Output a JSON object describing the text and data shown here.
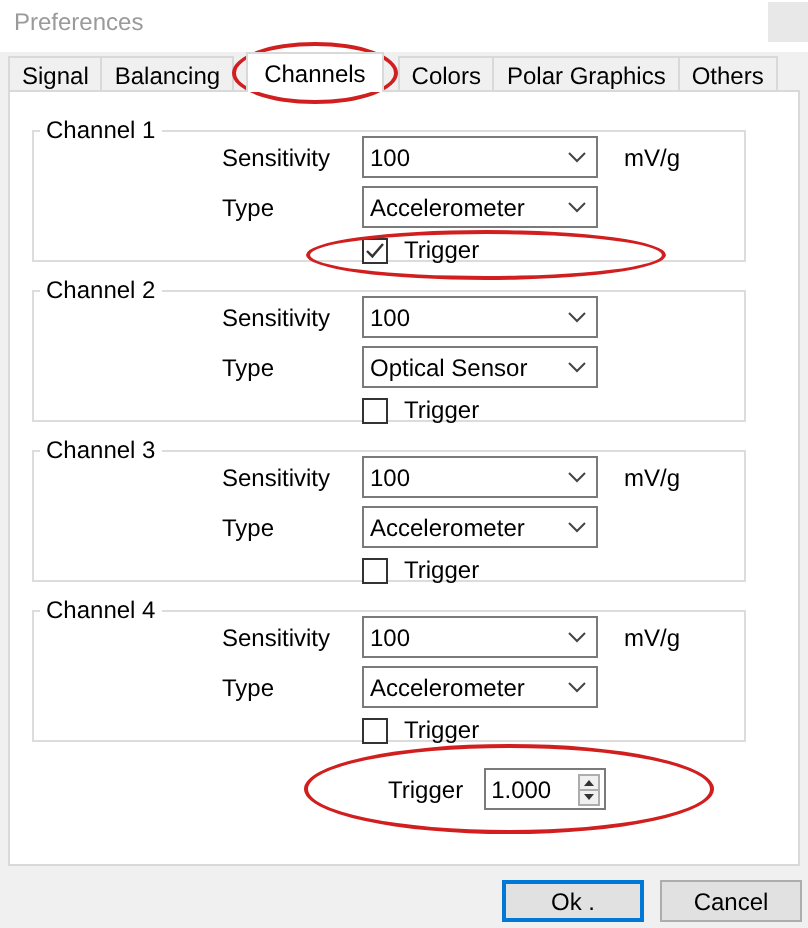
{
  "window": {
    "title": "Preferences"
  },
  "tabs": [
    {
      "label": "Signal",
      "selected": false,
      "highlighted": false
    },
    {
      "label": "Balancing",
      "selected": false,
      "highlighted": false
    },
    {
      "label": "Channels",
      "selected": true,
      "highlighted": true
    },
    {
      "label": "Colors",
      "selected": false,
      "highlighted": false
    },
    {
      "label": "Polar Graphics",
      "selected": false,
      "highlighted": false
    },
    {
      "label": "Others",
      "selected": false,
      "highlighted": false
    }
  ],
  "channels": [
    {
      "title": "Channel 1",
      "sensitivity_label": "Sensitivity",
      "sensitivity": "100",
      "unit": "mV/g",
      "type_label": "Type",
      "type": "Accelerometer",
      "trigger_label": "Trigger",
      "checked": true,
      "highlighted": true
    },
    {
      "title": "Channel 2",
      "sensitivity_label": "Sensitivity",
      "sensitivity": "100",
      "type_label": "Type",
      "type": "Optical Sensor",
      "trigger_label": "Trigger",
      "checked": false,
      "highlighted": false
    },
    {
      "title": "Channel 3",
      "sensitivity_label": "Sensitivity",
      "sensitivity": "100",
      "unit": "mV/g",
      "type_label": "Type",
      "type": "Accelerometer",
      "trigger_label": "Trigger",
      "checked": false,
      "highlighted": false
    },
    {
      "title": "Channel 4",
      "sensitivity_label": "Sensitivity",
      "sensitivity": "100",
      "unit": "mV/g",
      "type_label": "Type",
      "type": "Accelerometer",
      "trigger_label": "Trigger",
      "checked": false,
      "highlighted": false
    }
  ],
  "trigger": {
    "label": "Trigger",
    "value": "1.000",
    "highlighted": true
  },
  "buttons": [
    {
      "label": "Ok .",
      "default": true
    },
    {
      "label": "Cancel",
      "default": false
    }
  ]
}
